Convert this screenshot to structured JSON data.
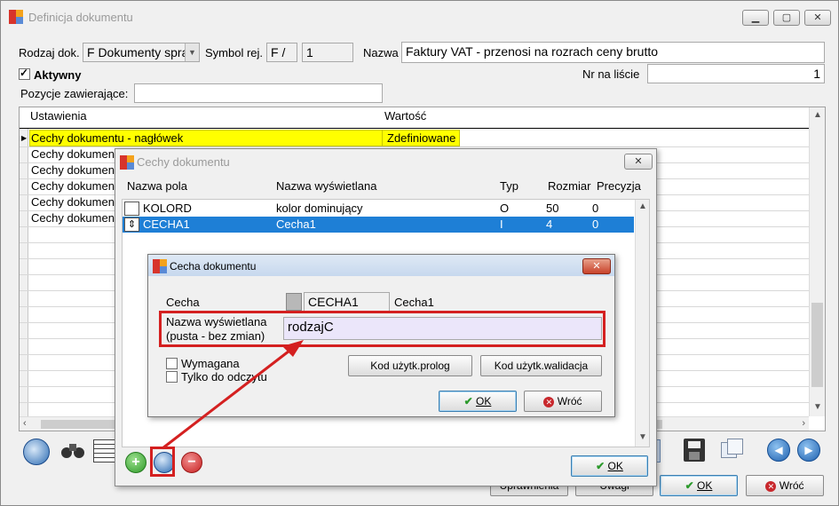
{
  "main": {
    "title": "Definicja dokumentu",
    "rodzaj_label": "Rodzaj dok.",
    "rodzaj_value": "F  Dokumenty spra",
    "symbol_label": "Symbol rej.",
    "symbol_value1": "F /",
    "symbol_value2": "1",
    "nazwa_label": "Nazwa",
    "nazwa_value": "Faktury VAT - przenosi na rozrach ceny brutto",
    "aktywny_label": "Aktywny",
    "nr_label": "Nr na liście",
    "nr_value": "1",
    "pozycje_label": "Pozycje zawierające:",
    "pozycje_value": "",
    "grid": {
      "col_settings": "Ustawienia",
      "col_value": "Wartość",
      "rows": [
        {
          "name": "Cechy dokumentu - nagłówek",
          "value": "Zdefiniowane"
        },
        {
          "name": "Cechy dokument",
          "value": ""
        },
        {
          "name": "Cechy dokument",
          "value": ""
        },
        {
          "name": "Cechy dokument",
          "value": ""
        },
        {
          "name": "Cechy dokument",
          "value": ""
        },
        {
          "name": "Cechy dokument",
          "value": ""
        }
      ]
    },
    "btn_uprawnienia": "Uprawnienia",
    "btn_uwagi": "Uwagi",
    "btn_ok": "OK",
    "btn_wroc": "Wróć"
  },
  "cechy": {
    "title": "Cechy dokumentu",
    "cols": {
      "nazwa_pola": "Nazwa pola",
      "nazwa_wysw": "Nazwa wyświetlana",
      "typ": "Typ",
      "rozmiar": "Rozmiar",
      "precyzja": "Precyzja"
    },
    "rows": [
      {
        "nazwa_pola": "KOLORD",
        "nazwa_wysw": "kolor dominujący",
        "typ": "O",
        "rozmiar": "50",
        "precyzja": "0"
      },
      {
        "nazwa_pola": "CECHA1",
        "nazwa_wysw": "Cecha1",
        "typ": "I",
        "rozmiar": "4",
        "precyzja": "0"
      }
    ],
    "btn_ok": "OK"
  },
  "cecha": {
    "title": "Cecha dokumentu",
    "cecha_label": "Cecha",
    "cecha_value": "CECHA1",
    "cecha_name": "Cecha1",
    "nazwa_label_1": "Nazwa wyświetlana",
    "nazwa_label_2": "(pusta - bez zmian)",
    "nazwa_value": "rodzajC",
    "wymagana_label": "Wymagana",
    "tylko_label": "Tylko do odczytu",
    "btn_prolog": "Kod użytk.prolog",
    "btn_walidacja": "Kod użytk.walidacja",
    "btn_ok": "OK",
    "btn_wroc": "Wróć"
  },
  "colors": {
    "highlight_yellow": "#ffff00",
    "selection_blue": "#1e7fd6",
    "annotation_red": "#d42020",
    "input_lavender": "#ebe6fa"
  }
}
